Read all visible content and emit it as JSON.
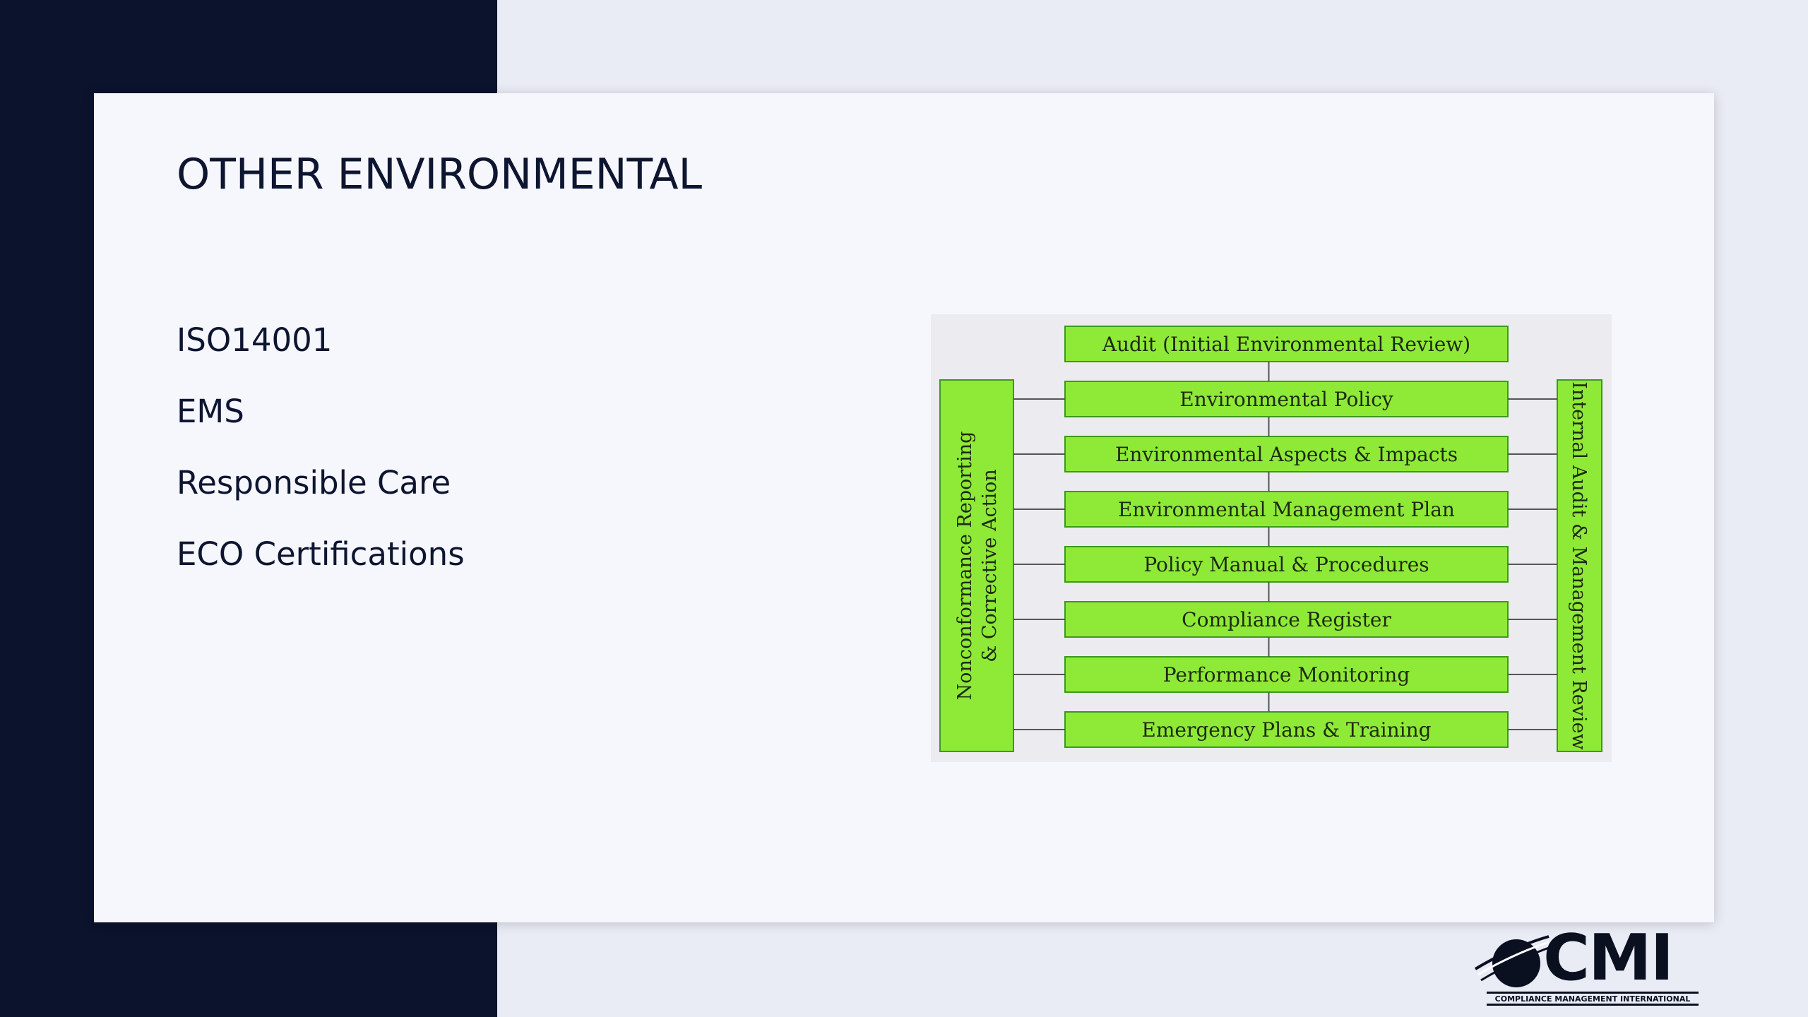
{
  "slide": {
    "title": "OTHER ENVIRONMENTAL",
    "bullets": [
      "ISO14001",
      "EMS",
      "Responsible Care",
      "ECO Certifications"
    ]
  },
  "diagram": {
    "boxes": [
      "Audit (Initial Environmental Review)",
      "Environmental Policy",
      "Environmental Aspects & Impacts",
      "Environmental Management Plan",
      "Policy Manual & Procedures",
      "Compliance Register",
      "Performance Monitoring",
      "Emergency Plans & Training"
    ],
    "left_label_line1": "Nonconformance Reporting",
    "left_label_line2": "& Corrective Action",
    "right_label": "Internal Audit & Management Review",
    "box_color": "#8fea37"
  },
  "logo": {
    "wordmark": "CMI",
    "subtitle": "COMPLIANCE MANAGEMENT INTERNATIONAL",
    "icon": "globe-swoosh-icon"
  }
}
